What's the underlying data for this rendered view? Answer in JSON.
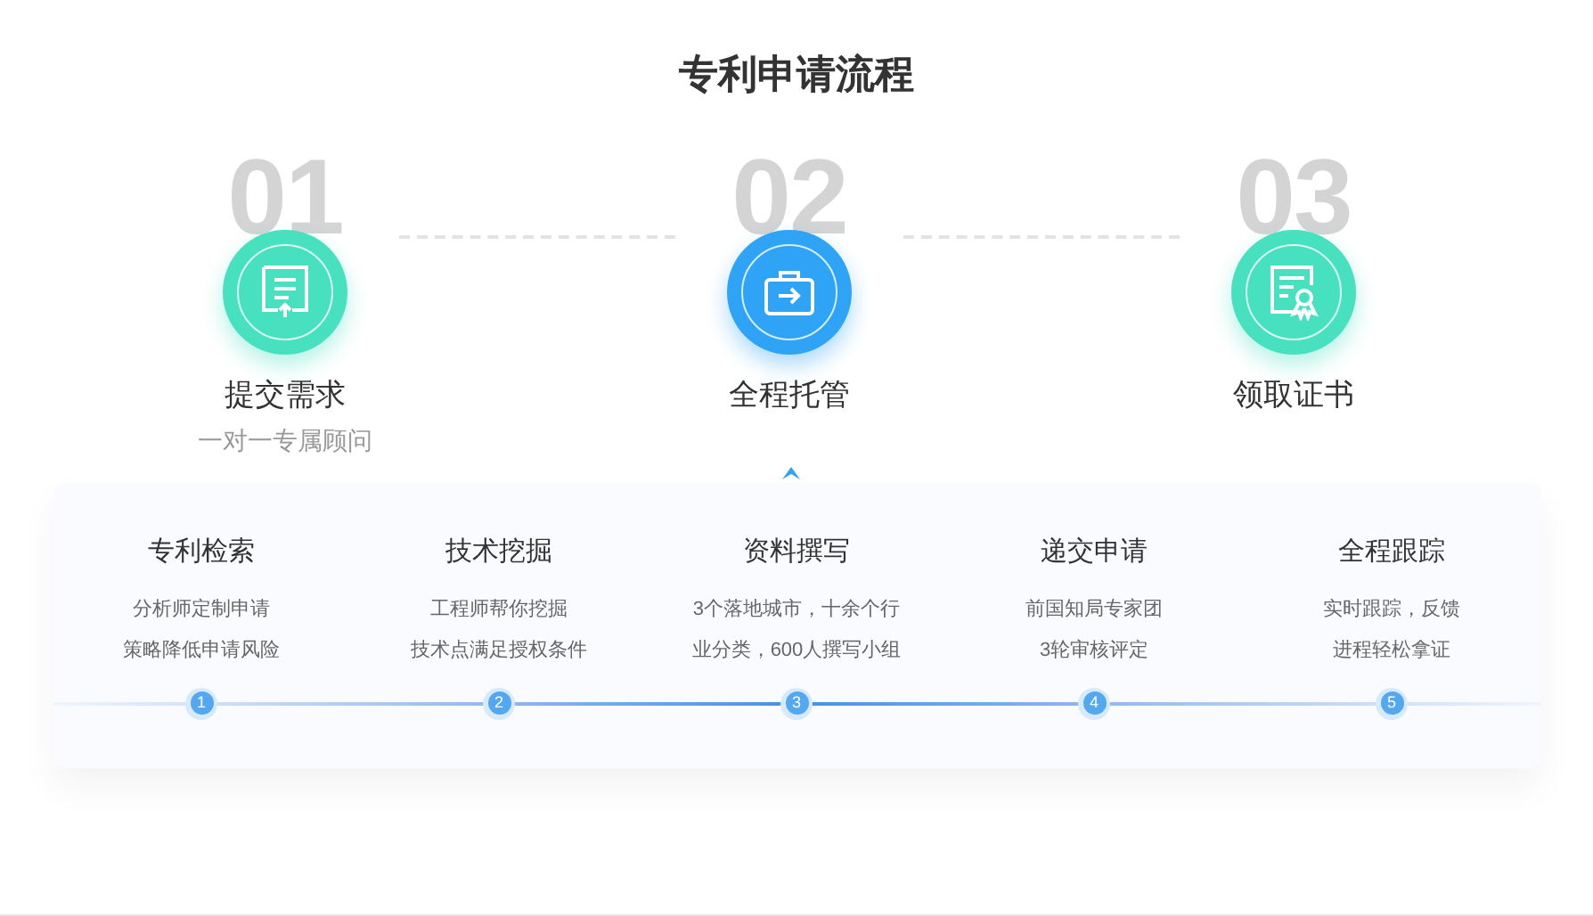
{
  "title": "专利申请流程",
  "steps": [
    {
      "number": "01",
      "label": "提交需求",
      "subtitle": "一对一专属顾问",
      "selected": false
    },
    {
      "number": "02",
      "label": "全程托管",
      "selected": true
    },
    {
      "number": "03",
      "label": "领取证书",
      "selected": false
    }
  ],
  "substeps": [
    {
      "title": "专利检索",
      "lines": [
        "分析师定制申请",
        "策略降低申请风险"
      ],
      "index": "1"
    },
    {
      "title": "技术挖掘",
      "lines": [
        "工程师帮你挖掘",
        "技术点满足授权条件"
      ],
      "index": "2"
    },
    {
      "title": "资料撰写",
      "lines": [
        "3个落地城市，十余个行",
        "业分类，600人撰写小组"
      ],
      "index": "3"
    },
    {
      "title": "递交申请",
      "lines": [
        "前国知局专家团",
        "3轮审核评定"
      ],
      "index": "4"
    },
    {
      "title": "全程跟踪",
      "lines": [
        "实时跟踪，反馈",
        "进程轻松拿证"
      ],
      "index": "5"
    }
  ]
}
